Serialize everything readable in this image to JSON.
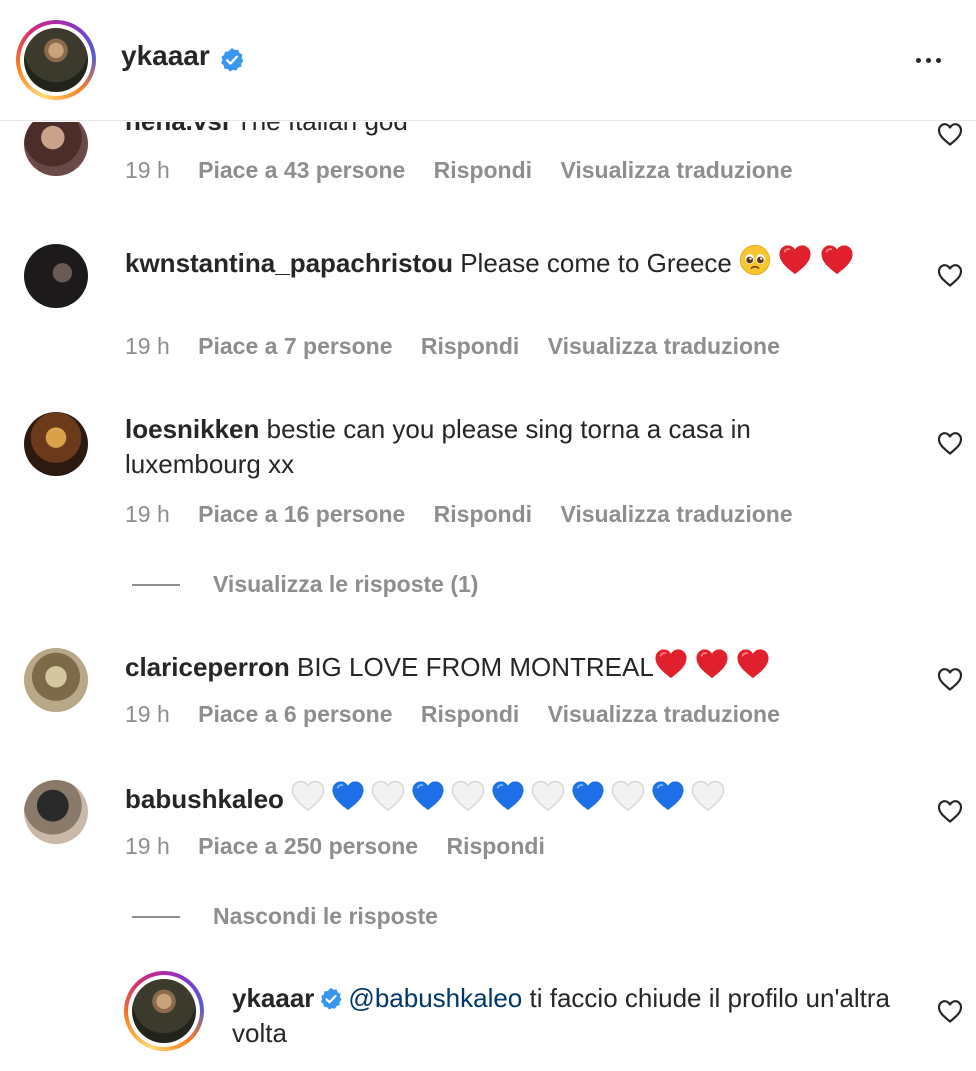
{
  "header": {
    "username": "ykaaar"
  },
  "comments": [
    {
      "username": "nena.vsl",
      "text": "The Italian god",
      "time": "19 h",
      "likes": "Piace a 43 persone",
      "reply": "Rispondi",
      "translate": "Visualizza traduzione"
    },
    {
      "username": "kwnstantina_papachristou",
      "text": "Please come to Greece",
      "time": "19 h",
      "likes": "Piace a 7 persone",
      "reply": "Rispondi",
      "translate": "Visualizza traduzione"
    },
    {
      "username": "loesnikken",
      "text": "bestie can you please sing torna a casa in luxembourg xx",
      "time": "19 h",
      "likes": "Piace a 16 persone",
      "reply": "Rispondi",
      "translate": "Visualizza traduzione",
      "replies_toggle": "Visualizza le risposte (1)"
    },
    {
      "username": "clariceperron",
      "text": "BIG LOVE FROM MONTREAL",
      "time": "19 h",
      "likes": "Piace a 6 persone",
      "reply": "Rispondi",
      "translate": "Visualizza traduzione"
    },
    {
      "username": "babushkaleo",
      "text": "",
      "time": "19 h",
      "likes": "Piace a 250 persone",
      "reply": "Rispondi",
      "replies_toggle": "Nascondi le risposte"
    }
  ],
  "reply": {
    "username": "ykaaar",
    "mention": "@babushkaleo",
    "text": "ti faccio chiude il profilo un'altra volta"
  },
  "icons": {
    "verified": "verified-badge-icon",
    "more": "more-options-icon",
    "like": "heart-outline-icon",
    "red_heart": "red-heart-emoji",
    "white_heart": "white-heart-emoji",
    "blue_heart": "blue-heart-emoji",
    "pleading": "pleading-face-emoji"
  },
  "colors": {
    "text": "#262626",
    "muted": "#8e8e8e",
    "verified": "#3897f0",
    "mention": "#00376b",
    "red_heart": "#e0202c",
    "blue_heart": "#1f6fe8"
  }
}
